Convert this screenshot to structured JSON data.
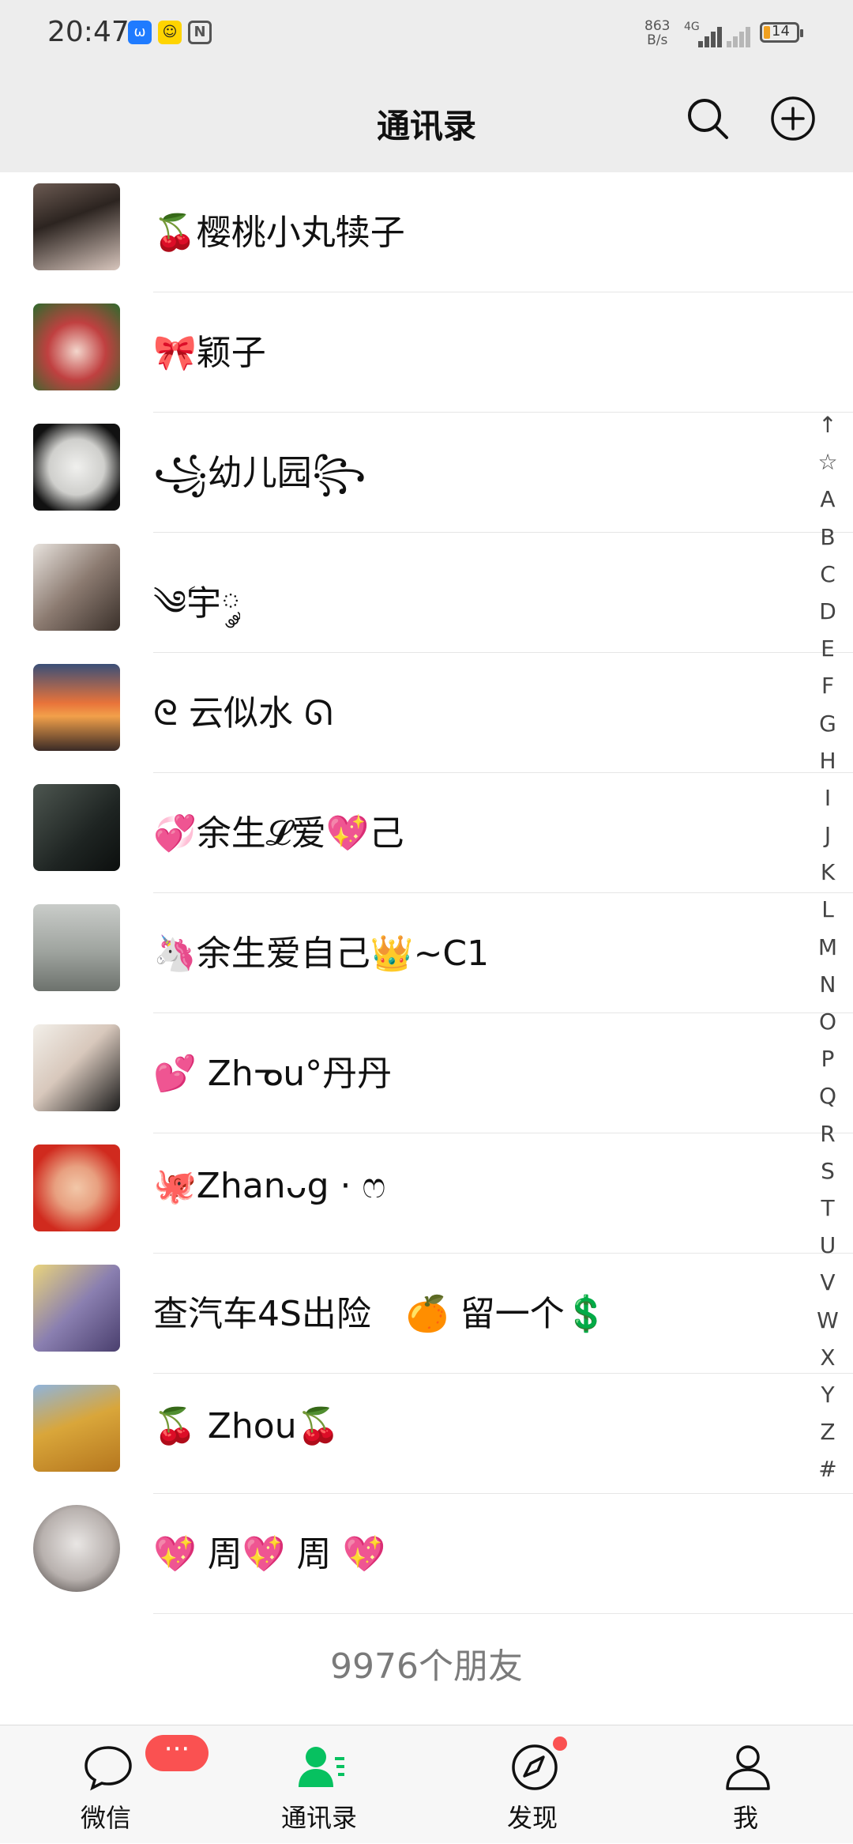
{
  "status_bar": {
    "time": "20:47",
    "net_speed_value": "863",
    "net_speed_unit": "B/s",
    "network_type": "4G",
    "battery": "14"
  },
  "header": {
    "title": "通讯录"
  },
  "contacts": [
    {
      "name": "🍒樱桃小丸犊子"
    },
    {
      "name": "🎀颖子"
    },
    {
      "name": "꧁幼儿园꧂"
    },
    {
      "name": "༄ؘ宇༘"
    },
    {
      "name": "ᘓ 云似水 ᘏ"
    },
    {
      "name": "💞余生𝓛爱💖己"
    },
    {
      "name": "🦄余生爱自己👑~C1"
    },
    {
      "name": "💕 Zhᓀu°丹丹"
    },
    {
      "name": "🐙Zhanᴗg · ෆ"
    },
    {
      "name": "查汽车4S出险　🍊 留一个💲"
    },
    {
      "name": "🍒 Zhou🍒"
    },
    {
      "name": "💖 周💖 周 💖"
    }
  ],
  "footer": {
    "friend_count": "9976个朋友"
  },
  "alpha_index": [
    "↑",
    "☆",
    "A",
    "B",
    "C",
    "D",
    "E",
    "F",
    "G",
    "H",
    "I",
    "J",
    "K",
    "L",
    "M",
    "N",
    "O",
    "P",
    "Q",
    "R",
    "S",
    "T",
    "U",
    "V",
    "W",
    "X",
    "Y",
    "Z",
    "#"
  ],
  "tabs": [
    {
      "label": "微信",
      "badge": "···"
    },
    {
      "label": "通讯录"
    },
    {
      "label": "发现"
    },
    {
      "label": "我"
    }
  ],
  "colors": {
    "accent_green": "#07c160",
    "badge_red": "#fa5151",
    "header_bg": "#ededed"
  }
}
